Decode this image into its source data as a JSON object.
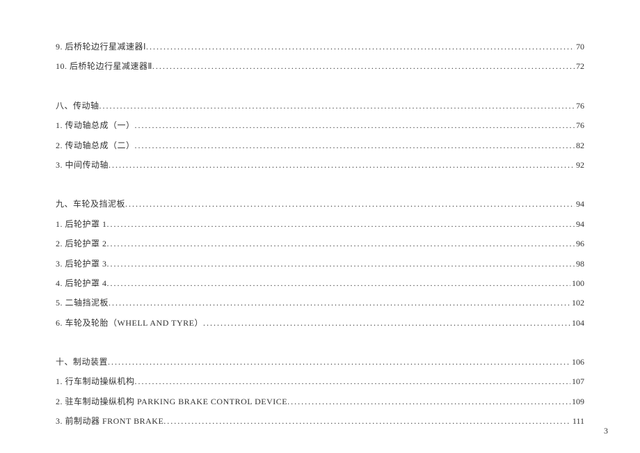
{
  "toc": [
    {
      "label": "9.  后桥轮边行星减速器Ⅰ",
      "page": "70",
      "gap_before": false
    },
    {
      "label": "10. 后桥轮边行星减速器Ⅱ",
      "page": "72",
      "gap_before": false
    },
    {
      "label": "八、传动轴",
      "page": "76",
      "gap_before": true
    },
    {
      "label": "1.  传动轴总成（一）",
      "page": "76",
      "gap_before": false
    },
    {
      "label": "2.  传动轴总成（二）",
      "page": "82",
      "gap_before": false
    },
    {
      "label": "3.  中间传动轴",
      "page": "92",
      "gap_before": false
    },
    {
      "label": "九、车轮及挡泥板",
      "page": "94",
      "gap_before": true
    },
    {
      "label": "1.  后轮护罩 1",
      "page": "94",
      "gap_before": false
    },
    {
      "label": "2.  后轮护罩 2",
      "page": "96",
      "gap_before": false
    },
    {
      "label": "3.  后轮护罩 3",
      "page": "98",
      "gap_before": false
    },
    {
      "label": "4.  后轮护罩 4",
      "page": "100",
      "gap_before": false
    },
    {
      "label": "5.  二轴挡泥板",
      "page": "102",
      "gap_before": false
    },
    {
      "label": "6.  车轮及轮胎（WHELL AND TYRE）",
      "page": "104",
      "gap_before": false
    },
    {
      "label": "十、制动装置",
      "page": "106",
      "gap_before": true
    },
    {
      "label": "1.  行车制动操纵机构",
      "page": "107",
      "gap_before": false
    },
    {
      "label": "2.  驻车制动操纵机构 PARKING BRAKE CONTROL DEVICE",
      "page": "109",
      "gap_before": false
    },
    {
      "label": "3.  前制动器 FRONT BRAKE",
      "page": "111",
      "gap_before": false
    }
  ],
  "page_number": "3"
}
